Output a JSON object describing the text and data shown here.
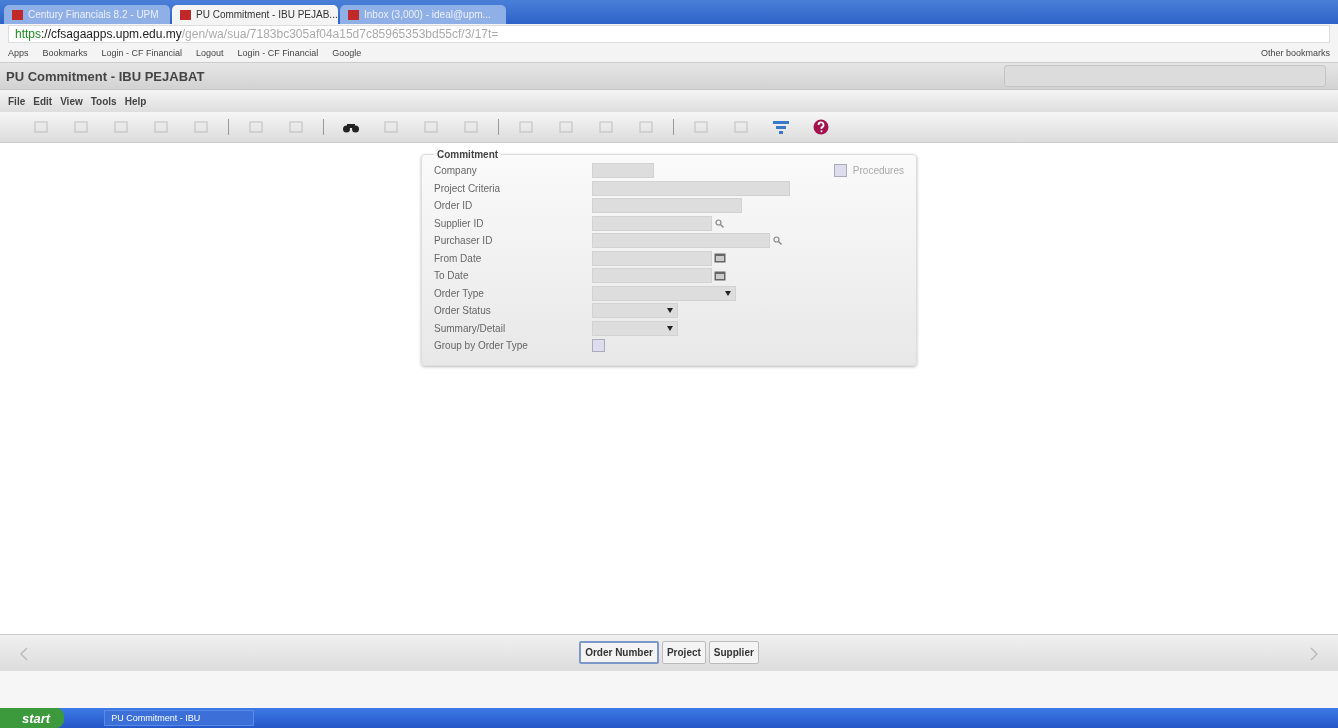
{
  "browser": {
    "tabs": [
      {
        "label": "Century Financials 8.2 - UPM",
        "selected": false
      },
      {
        "label": "PU Commitment - IBU PEJAB...",
        "selected": true
      },
      {
        "label": "Inbox (3,000) - ideal@upm...",
        "selected": false
      }
    ],
    "url": {
      "secure": "https",
      "host": "://cfsagaapps.upm.edu.my",
      "path": "/gen/wa/sua/7183bc305af04a15d7c85965353bd55cf/3/17t="
    },
    "bookmarks": [
      "Apps",
      "Bookmarks",
      "Login - CF Financial",
      "Logout",
      "Login - CF Financial",
      "Google"
    ],
    "other_bookmarks": "Other bookmarks"
  },
  "app": {
    "title": "PU Commitment - IBU PEJABAT",
    "menu": [
      "File",
      "Edit",
      "View",
      "Tools",
      "Help"
    ],
    "toolbar": [
      [
        {
          "disabled": true
        },
        {
          "disabled": true
        },
        {
          "disabled": true
        },
        {
          "disabled": true
        },
        {
          "disabled": true
        }
      ],
      [
        {
          "disabled": true
        },
        {
          "disabled": true
        }
      ],
      [
        {
          "disabled": false
        },
        {
          "disabled": true
        },
        {
          "disabled": true
        },
        {
          "disabled": true
        }
      ],
      [
        {
          "disabled": true
        },
        {
          "disabled": true
        },
        {
          "disabled": true
        },
        {
          "disabled": true
        }
      ],
      [
        {
          "disabled": true
        },
        {
          "disabled": true
        },
        {
          "disabled": false
        },
        {
          "disabled": false
        }
      ]
    ]
  },
  "form": {
    "legend": "Commitment",
    "procedures": {
      "label": "Procedures",
      "checked": false
    },
    "fields": [
      {
        "label": "Company",
        "kind": "text"
      },
      {
        "label": "Project Criteria",
        "kind": "text"
      },
      {
        "label": "Order ID",
        "kind": "text"
      },
      {
        "label": "Supplier ID",
        "kind": "lookup"
      },
      {
        "label": "Purchaser ID",
        "kind": "lookup"
      },
      {
        "label": "From Date",
        "kind": "date"
      },
      {
        "label": "To Date",
        "kind": "date"
      },
      {
        "label": "Order Type",
        "kind": "select"
      },
      {
        "label": "Order Status",
        "kind": "select"
      },
      {
        "label": "Summary/Detail",
        "kind": "select"
      },
      {
        "label": "Group by Order Type",
        "kind": "checkbox",
        "checked": false
      }
    ]
  },
  "bottom_tabs": [
    {
      "label": "Order Number",
      "selected": true
    },
    {
      "label": "Project",
      "selected": false
    },
    {
      "label": "Supplier",
      "selected": false
    }
  ],
  "taskbar": {
    "start": "start",
    "items": [
      "PU Commitment - IBU"
    ]
  }
}
